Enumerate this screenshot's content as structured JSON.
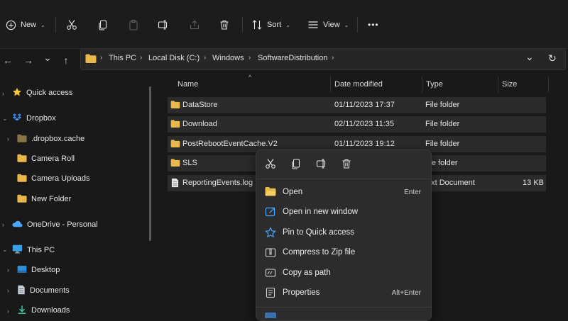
{
  "toolbar": {
    "new_label": "New",
    "sort_label": "Sort",
    "view_label": "View",
    "more_label": "•••"
  },
  "nav": {
    "back": "←",
    "forward": "→",
    "recent": "⌄",
    "up": "↑"
  },
  "address": {
    "crumbs": [
      "This PC",
      "Local Disk (C:)",
      "Windows",
      "SoftwareDistribution"
    ],
    "dropdown": "⌄",
    "refresh": "↻"
  },
  "sidebar": {
    "items": [
      {
        "label": "Quick access",
        "icon": "star-icon"
      },
      {
        "label": "Dropbox",
        "icon": "dropbox-icon"
      },
      {
        "label": ".dropbox.cache",
        "icon": "folder-icon"
      },
      {
        "label": "Camera Roll",
        "icon": "folder-icon"
      },
      {
        "label": "Camera Uploads",
        "icon": "folder-icon"
      },
      {
        "label": "New Folder",
        "icon": "folder-icon"
      },
      {
        "label": "OneDrive - Personal",
        "icon": "cloud-icon"
      },
      {
        "label": "This PC",
        "icon": "monitor-icon"
      },
      {
        "label": "Desktop",
        "icon": "desktop-icon"
      },
      {
        "label": "Documents",
        "icon": "document-icon"
      },
      {
        "label": "Downloads",
        "icon": "download-icon"
      }
    ]
  },
  "columns": {
    "name": "Name",
    "date": "Date modified",
    "type": "Type",
    "size": "Size"
  },
  "files": [
    {
      "name": "DataStore",
      "date": "01/11/2023 17:37",
      "type": "File folder",
      "size": ""
    },
    {
      "name": "Download",
      "date": "02/11/2023 11:35",
      "type": "File folder",
      "size": ""
    },
    {
      "name": "PostRebootEventCache.V2",
      "date": "01/11/2023 19:12",
      "type": "File folder",
      "size": ""
    },
    {
      "name": "SLS",
      "date": "",
      "type": "ile folder",
      "size": ""
    },
    {
      "name": "ReportingEvents.log",
      "date": "",
      "type": "ext Document",
      "size": "13 KB"
    }
  ],
  "context_menu": {
    "items": [
      {
        "label": "Open",
        "key": "Enter"
      },
      {
        "label": "Open in new window",
        "key": ""
      },
      {
        "label": "Pin to Quick access",
        "key": ""
      },
      {
        "label": "Compress to Zip file",
        "key": ""
      },
      {
        "label": "Copy as path",
        "key": ""
      },
      {
        "label": "Properties",
        "key": "Alt+Enter"
      }
    ]
  },
  "colors": {
    "folder": "#e8b84a",
    "accent": "#4aa8ff",
    "background": "#191919"
  }
}
